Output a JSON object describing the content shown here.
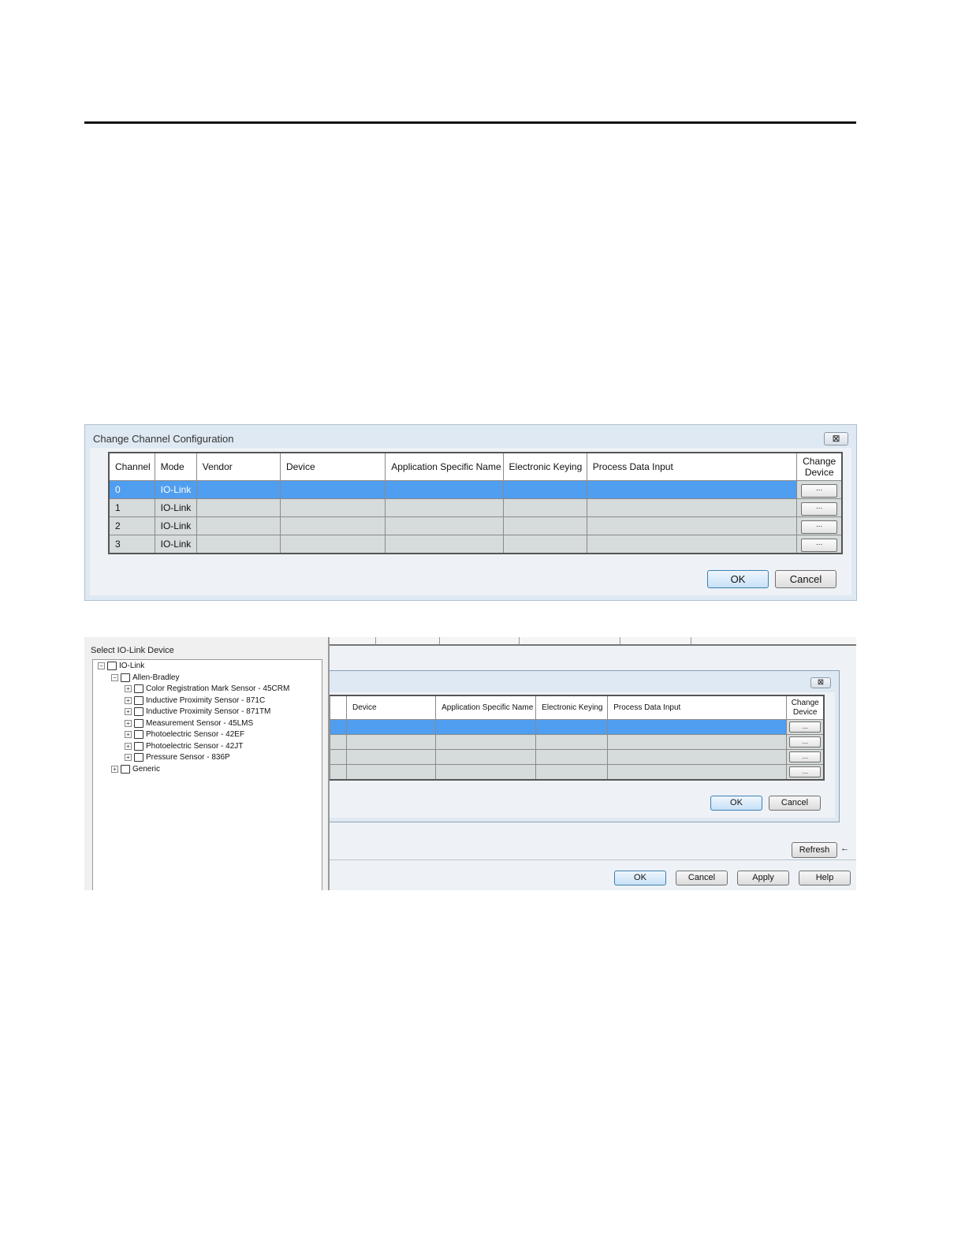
{
  "dialog1": {
    "title": "Change Channel Configuration",
    "close_glyph": "⊠",
    "columns": [
      "Channel",
      "Mode",
      "Vendor",
      "Device",
      "Application Specific Name",
      "Electronic Keying",
      "Process Data Input",
      "Change Device"
    ],
    "rows": [
      {
        "channel": "0",
        "mode": "IO-Link",
        "selected": true
      },
      {
        "channel": "1",
        "mode": "IO-Link",
        "selected": false
      },
      {
        "channel": "2",
        "mode": "IO-Link",
        "selected": false
      },
      {
        "channel": "3",
        "mode": "IO-Link",
        "selected": false
      }
    ],
    "change_button_label": "...",
    "ok_label": "OK",
    "cancel_label": "Cancel"
  },
  "device_panel": {
    "title": "Select IO-Link Device",
    "root": "IO-Link",
    "vendor": "Allen-Bradley",
    "items": [
      "Color Registration Mark Sensor - 45CRM",
      "Inductive Proximity Sensor - 871C",
      "Inductive Proximity Sensor - 871TM",
      "Measurement Sensor - 45LMS",
      "Photoelectric Sensor - 42EF",
      "Photoelectric Sensor - 42JT",
      "Pressure Sensor - 836P"
    ],
    "generic": "Generic"
  },
  "dialog2": {
    "close_glyph": "⊠",
    "columns": [
      "Device",
      "Application Specific Name",
      "Electronic Keying",
      "Process Data Input",
      "Change Device"
    ],
    "change_button_label": "...",
    "ok_label": "OK",
    "cancel_label": "Cancel"
  },
  "background_window": {
    "refresh_label": "Refresh",
    "arrow_glyph": "←",
    "ok_label": "OK",
    "cancel_label": "Cancel",
    "apply_label": "Apply",
    "help_label": "Help"
  },
  "colors": {
    "selection": "#4f9ef0",
    "row_background": "#d6dbdb",
    "dialog_frame": "#dfe9f3"
  }
}
